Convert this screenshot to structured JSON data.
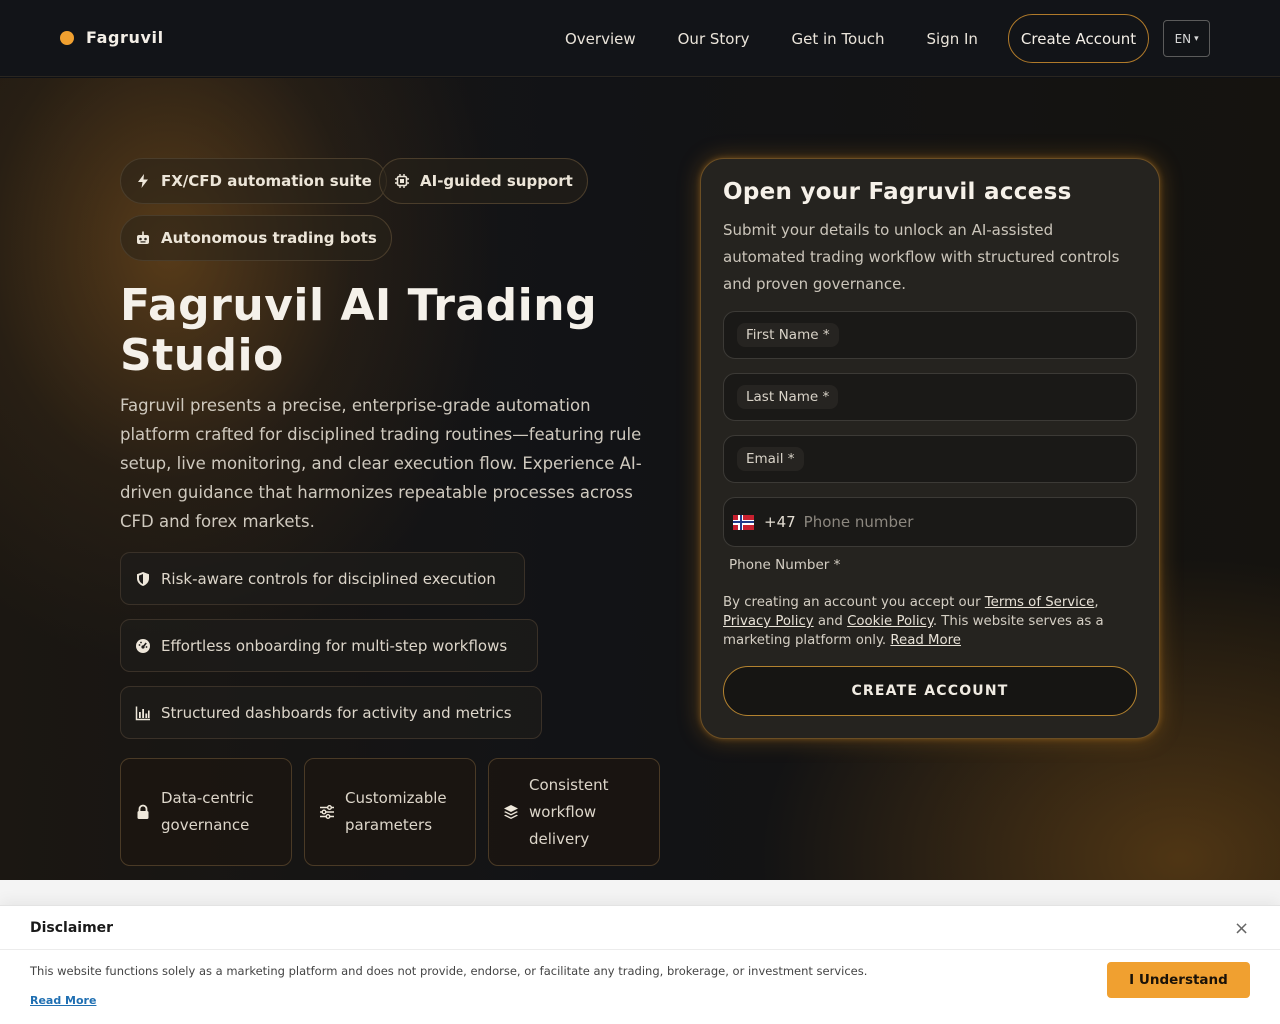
{
  "brand": {
    "name": "Fagruvil",
    "accent": "#f0a030"
  },
  "nav": {
    "links": [
      "Overview",
      "Our Story",
      "Get in Touch",
      "Sign In"
    ],
    "cta": "Create Account",
    "lang": "EN",
    "lang_caret": "▾"
  },
  "hero": {
    "pills": [
      {
        "label": "FX/CFD automation suite",
        "icon": "bolt-icon"
      },
      {
        "label": "AI-guided support",
        "icon": "chip-icon"
      },
      {
        "label": "Autonomous trading bots",
        "icon": "robot-icon"
      }
    ],
    "title": "Fagruvil AI Trading Studio",
    "description": "Fagruvil presents a precise, enterprise-grade automation platform crafted for disciplined trading routines—featuring rule setup, live monitoring, and clear execution flow. Experience AI-driven guidance that harmonizes repeatable processes across CFD and forex markets.",
    "features": [
      {
        "label": "Risk-aware controls for disciplined execution",
        "icon": "shield-icon"
      },
      {
        "label": "Effortless onboarding for multi-step workflows",
        "icon": "gauge-icon"
      },
      {
        "label": "Structured dashboards for activity and metrics",
        "icon": "bar-chart-icon"
      }
    ],
    "cards": [
      {
        "label": "Data-centric governance",
        "icon": "lock-icon"
      },
      {
        "label": "Customizable parameters",
        "icon": "sliders-icon"
      },
      {
        "label": "Consistent workflow delivery",
        "icon": "layers-icon"
      }
    ]
  },
  "form": {
    "title": "Open your Fagruvil access",
    "description": "Submit your details to unlock an AI-assisted automated trading workflow with structured controls and proven governance.",
    "first_name_label": "First Name *",
    "last_name_label": "Last Name *",
    "email_label": "Email *",
    "phone_dial": "+47",
    "phone_placeholder": "Phone number",
    "phone_caption": "Phone Number *",
    "terms_prefix": "By creating an account you accept our ",
    "terms_link": "Terms of Service",
    "terms_sep1": ",",
    "privacy_link": "Privacy Policy",
    "terms_and": " and ",
    "cookie_link": "Cookie Policy",
    "terms_suffix": ". This website serves as a marketing platform only. ",
    "read_more": "Read More",
    "submit": "CREATE ACCOUNT"
  },
  "disclaimer": {
    "title": "Disclaimer",
    "close": "×",
    "text": "This website functions solely as a marketing platform and does not provide, endorse, or facilitate any trading, brokerage, or investment services.",
    "read_more": "Read More",
    "button": "I Understand"
  }
}
